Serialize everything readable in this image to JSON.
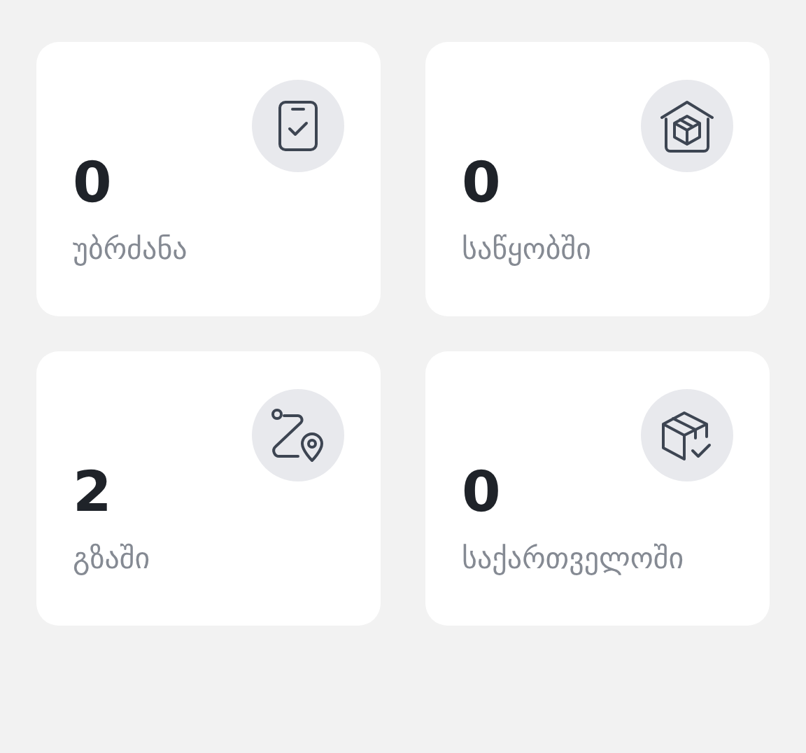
{
  "cards": [
    {
      "kind": "phone-check",
      "count": "0",
      "label": "უბრძანა"
    },
    {
      "kind": "warehouse",
      "count": "0",
      "label": "საწყობში"
    },
    {
      "kind": "route",
      "count": "2",
      "label": "გზაში"
    },
    {
      "kind": "box-check",
      "count": "0",
      "label": "საქართველოში"
    }
  ]
}
